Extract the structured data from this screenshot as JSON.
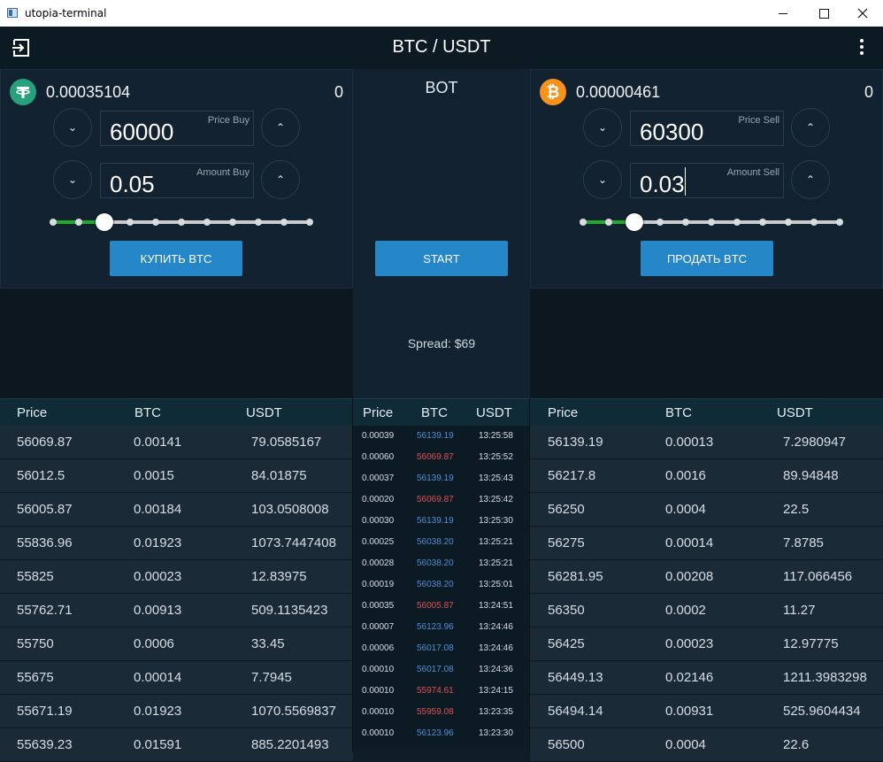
{
  "window": {
    "title": "utopia-terminal"
  },
  "header": {
    "pair": "BTC / USDT"
  },
  "buy": {
    "balance": "0.00035104",
    "count": "0",
    "coin_icon": "usdt-icon",
    "price_label": "Price Buy",
    "price_value": "60000",
    "amount_label": "Amount Buy",
    "amount_value": "0.05",
    "slider_fraction": 0.2,
    "button": "КУПИТЬ BTC"
  },
  "sell": {
    "balance": "0.00000461",
    "count": "0",
    "coin_icon": "btc-icon",
    "price_label": "Price Sell",
    "price_value": "60300",
    "amount_label": "Amount Sell",
    "amount_value": "0.03",
    "slider_fraction": 0.2,
    "button": "ПРОДАТЬ BTC"
  },
  "bot": {
    "title": "BOT",
    "start": "START",
    "spread": "Spread: $69"
  },
  "bids": {
    "headers": [
      "Price",
      "BTC",
      "USDT"
    ],
    "rows": [
      [
        "56069.87",
        "0.00141",
        "79.0585167"
      ],
      [
        "56012.5",
        "0.0015",
        "84.01875"
      ],
      [
        "56005.87",
        "0.00184",
        "103.0508008"
      ],
      [
        "55836.96",
        "0.01923",
        "1073.7447408"
      ],
      [
        "55825",
        "0.00023",
        "12.83975"
      ],
      [
        "55762.71",
        "0.00913",
        "509.1135423"
      ],
      [
        "55750",
        "0.0006",
        "33.45"
      ],
      [
        "55675",
        "0.00014",
        "7.7945"
      ],
      [
        "55671.19",
        "0.01923",
        "1070.5569837"
      ],
      [
        "55639.23",
        "0.01591",
        "885.2201493"
      ]
    ]
  },
  "asks": {
    "headers": [
      "Price",
      "BTC",
      "USDT"
    ],
    "rows": [
      [
        "56139.19",
        "0.00013",
        "7.2980947"
      ],
      [
        "56217.8",
        "0.0016",
        "89.94848"
      ],
      [
        "56250",
        "0.0004",
        "22.5"
      ],
      [
        "56275",
        "0.00014",
        "7.8785"
      ],
      [
        "56281.95",
        "0.00208",
        "117.066456"
      ],
      [
        "56350",
        "0.0002",
        "11.27"
      ],
      [
        "56425",
        "0.00023",
        "12.97775"
      ],
      [
        "56449.13",
        "0.02146",
        "1211.3983298"
      ],
      [
        "56494.14",
        "0.00931",
        "525.9604434"
      ],
      [
        "56500",
        "0.0004",
        "22.6"
      ]
    ]
  },
  "trades": {
    "headers": [
      "Price",
      "BTC",
      "USDT"
    ],
    "colors": {
      "buy": "#4f8fd6",
      "sell": "#e0505a"
    },
    "rows": [
      {
        "qty": "0.00039",
        "price": "56139.19",
        "time": "13:25:58",
        "side": "buy"
      },
      {
        "qty": "0.00060",
        "price": "56069.87",
        "time": "13:25:52",
        "side": "sell"
      },
      {
        "qty": "0.00037",
        "price": "56139.19",
        "time": "13:25:43",
        "side": "buy"
      },
      {
        "qty": "0.00020",
        "price": "56069.87",
        "time": "13:25:42",
        "side": "sell"
      },
      {
        "qty": "0.00030",
        "price": "56139.19",
        "time": "13:25:30",
        "side": "buy"
      },
      {
        "qty": "0.00025",
        "price": "56038.20",
        "time": "13:25:21",
        "side": "buy"
      },
      {
        "qty": "0.00028",
        "price": "56038.20",
        "time": "13:25:21",
        "side": "buy"
      },
      {
        "qty": "0.00019",
        "price": "56038.20",
        "time": "13:25:01",
        "side": "buy"
      },
      {
        "qty": "0.00035",
        "price": "56005.87",
        "time": "13:24:51",
        "side": "sell"
      },
      {
        "qty": "0.00007",
        "price": "56123.96",
        "time": "13:24:46",
        "side": "buy"
      },
      {
        "qty": "0.00006",
        "price": "56017.08",
        "time": "13:24:46",
        "side": "buy"
      },
      {
        "qty": "0.00010",
        "price": "56017.08",
        "time": "13:24:36",
        "side": "buy"
      },
      {
        "qty": "0.00010",
        "price": "55974.61",
        "time": "13:24:15",
        "side": "sell"
      },
      {
        "qty": "0.00010",
        "price": "55959.08",
        "time": "13:23:35",
        "side": "sell"
      },
      {
        "qty": "0.00010",
        "price": "56123.96",
        "time": "13:23:30",
        "side": "buy"
      }
    ]
  }
}
